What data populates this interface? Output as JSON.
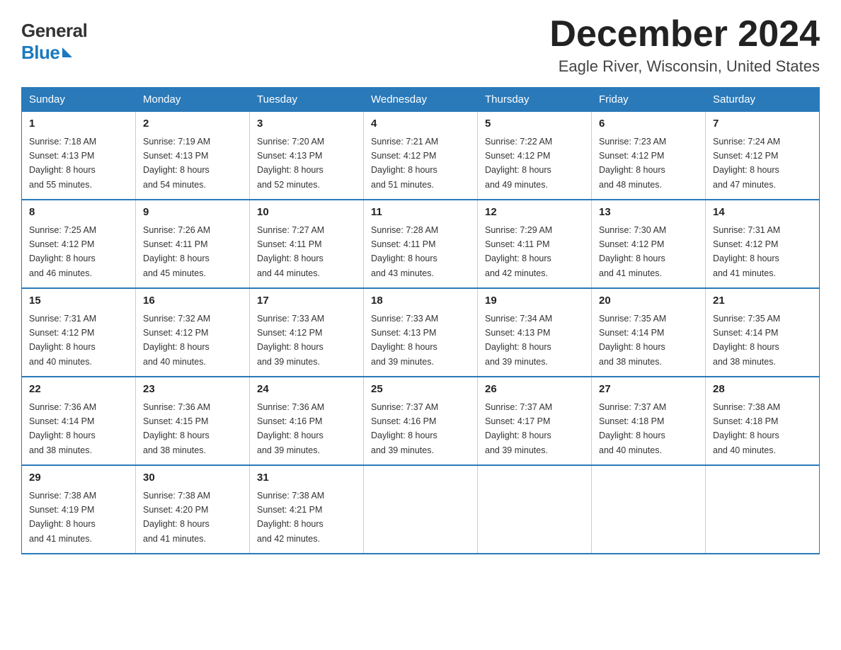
{
  "logo": {
    "general": "General",
    "blue": "Blue"
  },
  "title": "December 2024",
  "location": "Eagle River, Wisconsin, United States",
  "days_of_week": [
    "Sunday",
    "Monday",
    "Tuesday",
    "Wednesday",
    "Thursday",
    "Friday",
    "Saturday"
  ],
  "weeks": [
    [
      {
        "num": "1",
        "sunrise": "7:18 AM",
        "sunset": "4:13 PM",
        "daylight": "8 hours and 55 minutes."
      },
      {
        "num": "2",
        "sunrise": "7:19 AM",
        "sunset": "4:13 PM",
        "daylight": "8 hours and 54 minutes."
      },
      {
        "num": "3",
        "sunrise": "7:20 AM",
        "sunset": "4:13 PM",
        "daylight": "8 hours and 52 minutes."
      },
      {
        "num": "4",
        "sunrise": "7:21 AM",
        "sunset": "4:12 PM",
        "daylight": "8 hours and 51 minutes."
      },
      {
        "num": "5",
        "sunrise": "7:22 AM",
        "sunset": "4:12 PM",
        "daylight": "8 hours and 49 minutes."
      },
      {
        "num": "6",
        "sunrise": "7:23 AM",
        "sunset": "4:12 PM",
        "daylight": "8 hours and 48 minutes."
      },
      {
        "num": "7",
        "sunrise": "7:24 AM",
        "sunset": "4:12 PM",
        "daylight": "8 hours and 47 minutes."
      }
    ],
    [
      {
        "num": "8",
        "sunrise": "7:25 AM",
        "sunset": "4:12 PM",
        "daylight": "8 hours and 46 minutes."
      },
      {
        "num": "9",
        "sunrise": "7:26 AM",
        "sunset": "4:11 PM",
        "daylight": "8 hours and 45 minutes."
      },
      {
        "num": "10",
        "sunrise": "7:27 AM",
        "sunset": "4:11 PM",
        "daylight": "8 hours and 44 minutes."
      },
      {
        "num": "11",
        "sunrise": "7:28 AM",
        "sunset": "4:11 PM",
        "daylight": "8 hours and 43 minutes."
      },
      {
        "num": "12",
        "sunrise": "7:29 AM",
        "sunset": "4:11 PM",
        "daylight": "8 hours and 42 minutes."
      },
      {
        "num": "13",
        "sunrise": "7:30 AM",
        "sunset": "4:12 PM",
        "daylight": "8 hours and 41 minutes."
      },
      {
        "num": "14",
        "sunrise": "7:31 AM",
        "sunset": "4:12 PM",
        "daylight": "8 hours and 41 minutes."
      }
    ],
    [
      {
        "num": "15",
        "sunrise": "7:31 AM",
        "sunset": "4:12 PM",
        "daylight": "8 hours and 40 minutes."
      },
      {
        "num": "16",
        "sunrise": "7:32 AM",
        "sunset": "4:12 PM",
        "daylight": "8 hours and 40 minutes."
      },
      {
        "num": "17",
        "sunrise": "7:33 AM",
        "sunset": "4:12 PM",
        "daylight": "8 hours and 39 minutes."
      },
      {
        "num": "18",
        "sunrise": "7:33 AM",
        "sunset": "4:13 PM",
        "daylight": "8 hours and 39 minutes."
      },
      {
        "num": "19",
        "sunrise": "7:34 AM",
        "sunset": "4:13 PM",
        "daylight": "8 hours and 39 minutes."
      },
      {
        "num": "20",
        "sunrise": "7:35 AM",
        "sunset": "4:14 PM",
        "daylight": "8 hours and 38 minutes."
      },
      {
        "num": "21",
        "sunrise": "7:35 AM",
        "sunset": "4:14 PM",
        "daylight": "8 hours and 38 minutes."
      }
    ],
    [
      {
        "num": "22",
        "sunrise": "7:36 AM",
        "sunset": "4:14 PM",
        "daylight": "8 hours and 38 minutes."
      },
      {
        "num": "23",
        "sunrise": "7:36 AM",
        "sunset": "4:15 PM",
        "daylight": "8 hours and 38 minutes."
      },
      {
        "num": "24",
        "sunrise": "7:36 AM",
        "sunset": "4:16 PM",
        "daylight": "8 hours and 39 minutes."
      },
      {
        "num": "25",
        "sunrise": "7:37 AM",
        "sunset": "4:16 PM",
        "daylight": "8 hours and 39 minutes."
      },
      {
        "num": "26",
        "sunrise": "7:37 AM",
        "sunset": "4:17 PM",
        "daylight": "8 hours and 39 minutes."
      },
      {
        "num": "27",
        "sunrise": "7:37 AM",
        "sunset": "4:18 PM",
        "daylight": "8 hours and 40 minutes."
      },
      {
        "num": "28",
        "sunrise": "7:38 AM",
        "sunset": "4:18 PM",
        "daylight": "8 hours and 40 minutes."
      }
    ],
    [
      {
        "num": "29",
        "sunrise": "7:38 AM",
        "sunset": "4:19 PM",
        "daylight": "8 hours and 41 minutes."
      },
      {
        "num": "30",
        "sunrise": "7:38 AM",
        "sunset": "4:20 PM",
        "daylight": "8 hours and 41 minutes."
      },
      {
        "num": "31",
        "sunrise": "7:38 AM",
        "sunset": "4:21 PM",
        "daylight": "8 hours and 42 minutes."
      },
      null,
      null,
      null,
      null
    ]
  ],
  "labels": {
    "sunrise": "Sunrise:",
    "sunset": "Sunset:",
    "daylight": "Daylight:"
  }
}
